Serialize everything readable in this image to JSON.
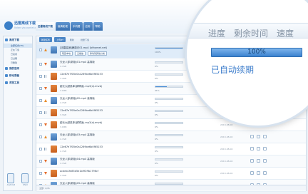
{
  "app": {
    "brand": "迅雷离线下载",
    "brand_sub": "lixian.vip.xunlei.com"
  },
  "nav": {
    "tabs": [
      {
        "label": "迅雷离线下载",
        "active": true
      },
      {
        "label": "高清影视"
      },
      {
        "label": "手机看"
      },
      {
        "label": "应用"
      },
      {
        "label": "帮助"
      }
    ]
  },
  "sidebar": {
    "title": "离线下载",
    "items": [
      {
        "label": "全部任务(35)",
        "active": true
      },
      {
        "label": "正在下载"
      },
      {
        "label": "已完成"
      },
      {
        "label": "已过期"
      },
      {
        "label": "已删除"
      }
    ],
    "sections": [
      "我的空间",
      "移动观看",
      "浏览工具"
    ],
    "footer": [
      "Android",
      "iPad"
    ]
  },
  "toolbar": {
    "new_task": "新建任务",
    "bt_task": "上传BT",
    "refresh": "刷新",
    "more": "批量下载"
  },
  "selected_row": {
    "name": "鹿鼎记.mp4 (bthomet.net)",
    "size": "227KB",
    "actions": [
      "取回本地",
      "云播放",
      "移动到其他分类"
    ]
  },
  "rows": [
    {
      "name": "[迅雷高速]鹿鼎记01.mp4 (bthomet.net)",
      "size": "227KB",
      "progress": 100,
      "pct": "100%",
      "date": "2013-08-02",
      "state": "up",
      "type": "video",
      "selected": true
    },
    {
      "name": "天龙八部(新版)01.mp4 高清版",
      "size": "4.7GB",
      "progress": 0,
      "pct": "0%",
      "date": "2013-08-02",
      "state": "down",
      "type": "video"
    },
    {
      "name": "12e67e7f05e0a1269be6b0f65153",
      "size": "3.4GB",
      "progress": 0,
      "pct": "0%",
      "date": "2013-08-02",
      "state": "pause",
      "type": "file"
    },
    {
      "name": "越长大越孤单(钢琴版).mp3(dj.rmvb)",
      "size": "3.1MB",
      "progress": 41,
      "pct": "41%",
      "date": "2013-08-02",
      "state": "down",
      "type": "file"
    },
    {
      "name": "天龙八部(新版)02.mp4 高清版",
      "size": "4.7GB",
      "progress": 0,
      "pct": "0%",
      "date": "2013-08-02",
      "state": "up",
      "type": "video"
    },
    {
      "name": "12e67e7f05e0a1269be6b0f65153",
      "size": "3.3GB",
      "progress": 0,
      "pct": "0%",
      "date": "2013-08-02",
      "state": "pause",
      "type": "file"
    },
    {
      "name": "越长大越孤单(钢琴版).mp3(dj.rmvb)",
      "size": "3.1MB",
      "progress": 0,
      "pct": "0%",
      "date": "2013-08-02",
      "state": "down",
      "type": "file"
    },
    {
      "name": "天龙八部(新版)03.mp4 高清版",
      "size": "4.7GB",
      "progress": 0,
      "pct": "0%",
      "date": "2013-08-02",
      "state": "up",
      "type": "video"
    },
    {
      "name": "12e67e7f05e0a1269be6b0f65153",
      "size": "2.7GB",
      "progress": 0,
      "pct": "0%",
      "date": "2013-08-02",
      "state": "pause",
      "type": "file"
    },
    {
      "name": "天龙八部(新版)04.mp4 高清版",
      "size": "4.7GB",
      "progress": 0,
      "pct": "0%",
      "date": "2013-08-02",
      "state": "down",
      "type": "video"
    },
    {
      "name": "acdeb1fe85d5e1b9f2ffb1796cf",
      "size": "2.3GB",
      "progress": 0,
      "pct": "0%",
      "date": "2013-08-02",
      "state": "down",
      "type": "file"
    },
    {
      "name": "天龙八部(新版)05.mp4 高清版",
      "size": "4.7GB",
      "progress": 0,
      "pct": "0%",
      "date": "2013-08-02",
      "state": "up",
      "type": "video"
    }
  ],
  "statusbar": {
    "text": "全部: 1/35"
  },
  "lens": {
    "col1": "进度",
    "col2": "剩余时间",
    "col3": "速度",
    "pct": "100%",
    "progress": 100,
    "note": "已自动续期"
  },
  "colors": {
    "accent": "#3b82cf",
    "orange": "#e46b2a"
  }
}
